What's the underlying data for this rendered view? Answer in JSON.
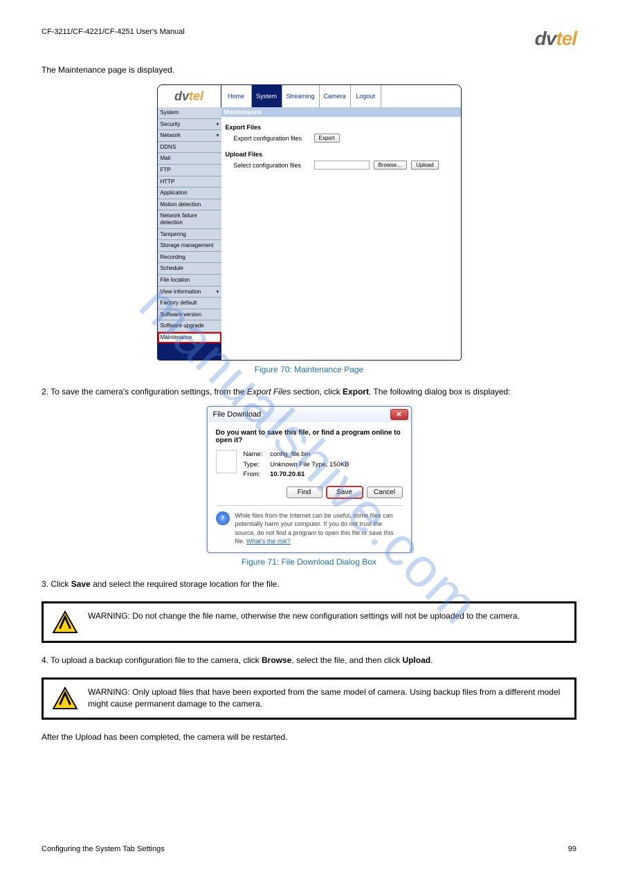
{
  "header": {
    "doc_title": "CF-3211/CF-4221/CF-4251 User's Manual"
  },
  "logo": {
    "dv": "dv",
    "tel": "tel"
  },
  "intro": "The Maintenance page is displayed.",
  "camera_ui": {
    "tabs": [
      "Home",
      "System",
      "Streaming",
      "Camera",
      "Logout"
    ],
    "active_tab_index": 1,
    "sidebar": [
      {
        "label": "System"
      },
      {
        "label": "Security",
        "dropdown": true
      },
      {
        "label": "Network",
        "dropdown": true
      },
      {
        "label": "DDNS"
      },
      {
        "label": "Mail"
      },
      {
        "label": "FTP"
      },
      {
        "label": "HTTP"
      },
      {
        "label": "Application"
      },
      {
        "label": "Motion detection"
      },
      {
        "label": "Network failure detection"
      },
      {
        "label": "Tampering"
      },
      {
        "label": "Storage management"
      },
      {
        "label": "Recording"
      },
      {
        "label": "Schedule"
      },
      {
        "label": "File location"
      },
      {
        "label": "View information",
        "dropdown": true
      },
      {
        "label": "Factory default"
      },
      {
        "label": "Software version"
      },
      {
        "label": "Software upgrade"
      },
      {
        "label": "Maintenance",
        "selected": true
      }
    ],
    "main": {
      "section_title": "Maintenance",
      "export": {
        "heading": "Export Files",
        "row_label": "Export configuration files",
        "button": "Export"
      },
      "upload": {
        "heading": "Upload Files",
        "row_label": "Select configuration files",
        "browse": "Browse…",
        "upload": "Upload"
      }
    }
  },
  "fig1_caption": "Figure 70: Maintenance Page",
  "step2": {
    "num": "2.",
    "text_a": "To save the camera's configuration settings, from the ",
    "em": "Export Files",
    "text_b": " section, click ",
    "strong": "Export",
    "text_c": ". The following dialog box is displayed:"
  },
  "file_download": {
    "title": "File Download",
    "question": "Do you want to save this file, or find a program online to open it?",
    "name_lbl": "Name:",
    "name_val": "config_file.bin",
    "type_lbl": "Type:",
    "type_val": "Unknown File Type, 150KB",
    "from_lbl": "From:",
    "from_val": "10.70.20.61",
    "buttons": {
      "find": "Find",
      "save": "Save",
      "cancel": "Cancel"
    },
    "warn_text": "While files from the Internet can be useful, some files can potentially harm your computer. If you do not trust the source, do not find a program to open this file or save this file. ",
    "warn_link": "What's the risk?"
  },
  "fig2_caption": "Figure 71: File Download Dialog Box",
  "step3": {
    "num": "3.",
    "text_a": "Click ",
    "strong": "Save",
    "text_b": " and select the required storage location for the file."
  },
  "warn1": "WARNING: Do not change the file name, otherwise the new configuration settings will not be uploaded to the camera.",
  "step4": {
    "num": "4.",
    "text_a": "To upload a backup configuration file to the camera, click ",
    "strong1": "Browse",
    "text_b": ", select the file, and then click ",
    "strong2": "Upload",
    "text_c": "."
  },
  "warn2": "WARNING: Only upload files that have been exported from the same model of camera. Using backup files from a different model might cause permanent damage to the camera.",
  "after_upload": "After the Upload has been completed, the camera will be restarted.",
  "watermark": "manualshive.com",
  "footer": {
    "left": "Configuring the System Tab Settings",
    "right": "99"
  }
}
